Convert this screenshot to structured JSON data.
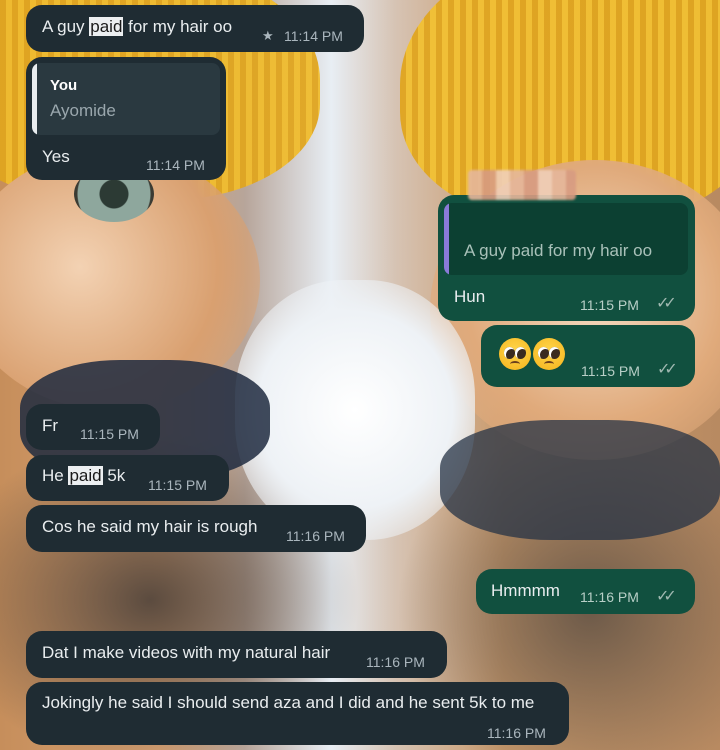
{
  "chat": {
    "messages": [
      {
        "text_before": "A guy ",
        "highlight": "paid",
        "text_after": " for my hair oo",
        "time": "11:14 PM",
        "starred": true
      },
      {
        "quoted_sender": "You",
        "quoted_text": "Ayomide",
        "text": "Yes",
        "time": "11:14 PM"
      },
      {
        "quoted_text": "A guy paid for my hair oo",
        "text": "Hun",
        "time": "11:15 PM"
      },
      {
        "emoji_description": "pleading face pleading face",
        "time": "11:15 PM"
      },
      {
        "text": "Fr",
        "time": "11:15 PM"
      },
      {
        "text_before": "He ",
        "highlight": "paid",
        "text_after": " 5k",
        "time": "11:15 PM"
      },
      {
        "text": "Cos he said my hair is rough",
        "time": "11:16 PM"
      },
      {
        "text": "Hmmmm",
        "time": "11:16 PM"
      },
      {
        "text": "Dat I make videos with my natural hair",
        "time": "11:16 PM"
      },
      {
        "text": "Jokingly he said I should send aza and I did and he sent 5k to me",
        "time": "11:16 PM"
      }
    ]
  },
  "icons": {
    "star": "star-icon",
    "read_receipt": "double-check-icon",
    "emoji": "pleading-face-emoji"
  },
  "colors": {
    "incoming_bubble": "#1f2c33",
    "outgoing_bubble": "#11503f",
    "highlight": "#eceff1"
  }
}
